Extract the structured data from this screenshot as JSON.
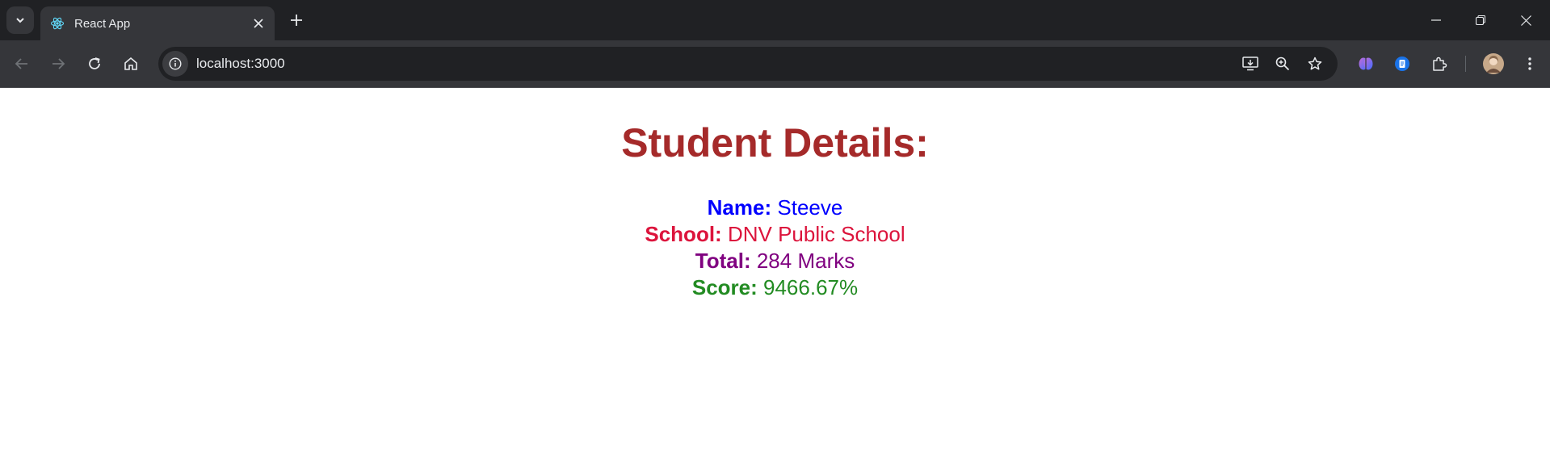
{
  "browser": {
    "tab_title": "React App",
    "url": "localhost:3000"
  },
  "page": {
    "title": "Student Details:",
    "rows": [
      {
        "label": "Name:",
        "value": "Steeve",
        "color": "#0000ff"
      },
      {
        "label": "School:",
        "value": "DNV Public School",
        "color": "#dc143c"
      },
      {
        "label": "Total:",
        "value": "284 Marks",
        "color": "#800080"
      },
      {
        "label": "Score:",
        "value": "9466.67%",
        "color": "#228b22"
      }
    ]
  },
  "colors": {
    "title": "#a52a2a",
    "chrome_dark": "#202124",
    "chrome_tab": "#35363a"
  },
  "icons": [
    "tab-search-icon",
    "react-favicon-icon",
    "close-icon",
    "plus-icon",
    "minimize-icon",
    "restore-icon",
    "window-close-icon",
    "back-arrow-icon",
    "forward-arrow-icon",
    "reload-icon",
    "home-icon",
    "info-icon",
    "install-app-icon",
    "zoom-icon",
    "star-icon",
    "extension-brain-icon",
    "extension-doc-icon",
    "puzzle-icon",
    "avatar",
    "kebab-menu-icon"
  ]
}
